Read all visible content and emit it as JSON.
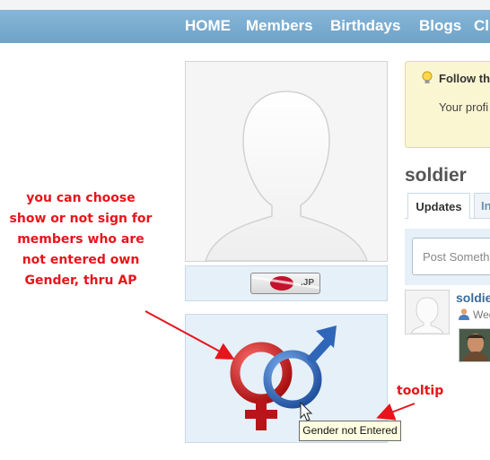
{
  "nav": {
    "items": [
      {
        "label": "HOME"
      },
      {
        "label": "Members"
      },
      {
        "label": "Birthdays"
      },
      {
        "label": "Blogs"
      },
      {
        "label": "Cl"
      }
    ]
  },
  "profile": {
    "flag_text": ".JP"
  },
  "follow": {
    "title": "Follow th",
    "text": "Your profi"
  },
  "user": {
    "name": "soldier"
  },
  "tabs": [
    {
      "label": "Updates",
      "active": true
    },
    {
      "label": "In",
      "active": false
    }
  ],
  "post": {
    "placeholder": "Post Somethi"
  },
  "feed": {
    "name": "soldie",
    "date": "Wed"
  },
  "annotations": {
    "note_lines": [
      "you can choose",
      "show or not sign for",
      "members who are",
      "not entered own",
      "Gender, thru AP"
    ],
    "tooltip_label": "tooltip"
  },
  "tooltip": {
    "text": "Gender not Entered"
  },
  "colors": {
    "nav_bar": "#7aacd0",
    "annotation": "#e8141c",
    "female_symbol": "#c41c1c",
    "male_symbol": "#2f66b8"
  }
}
